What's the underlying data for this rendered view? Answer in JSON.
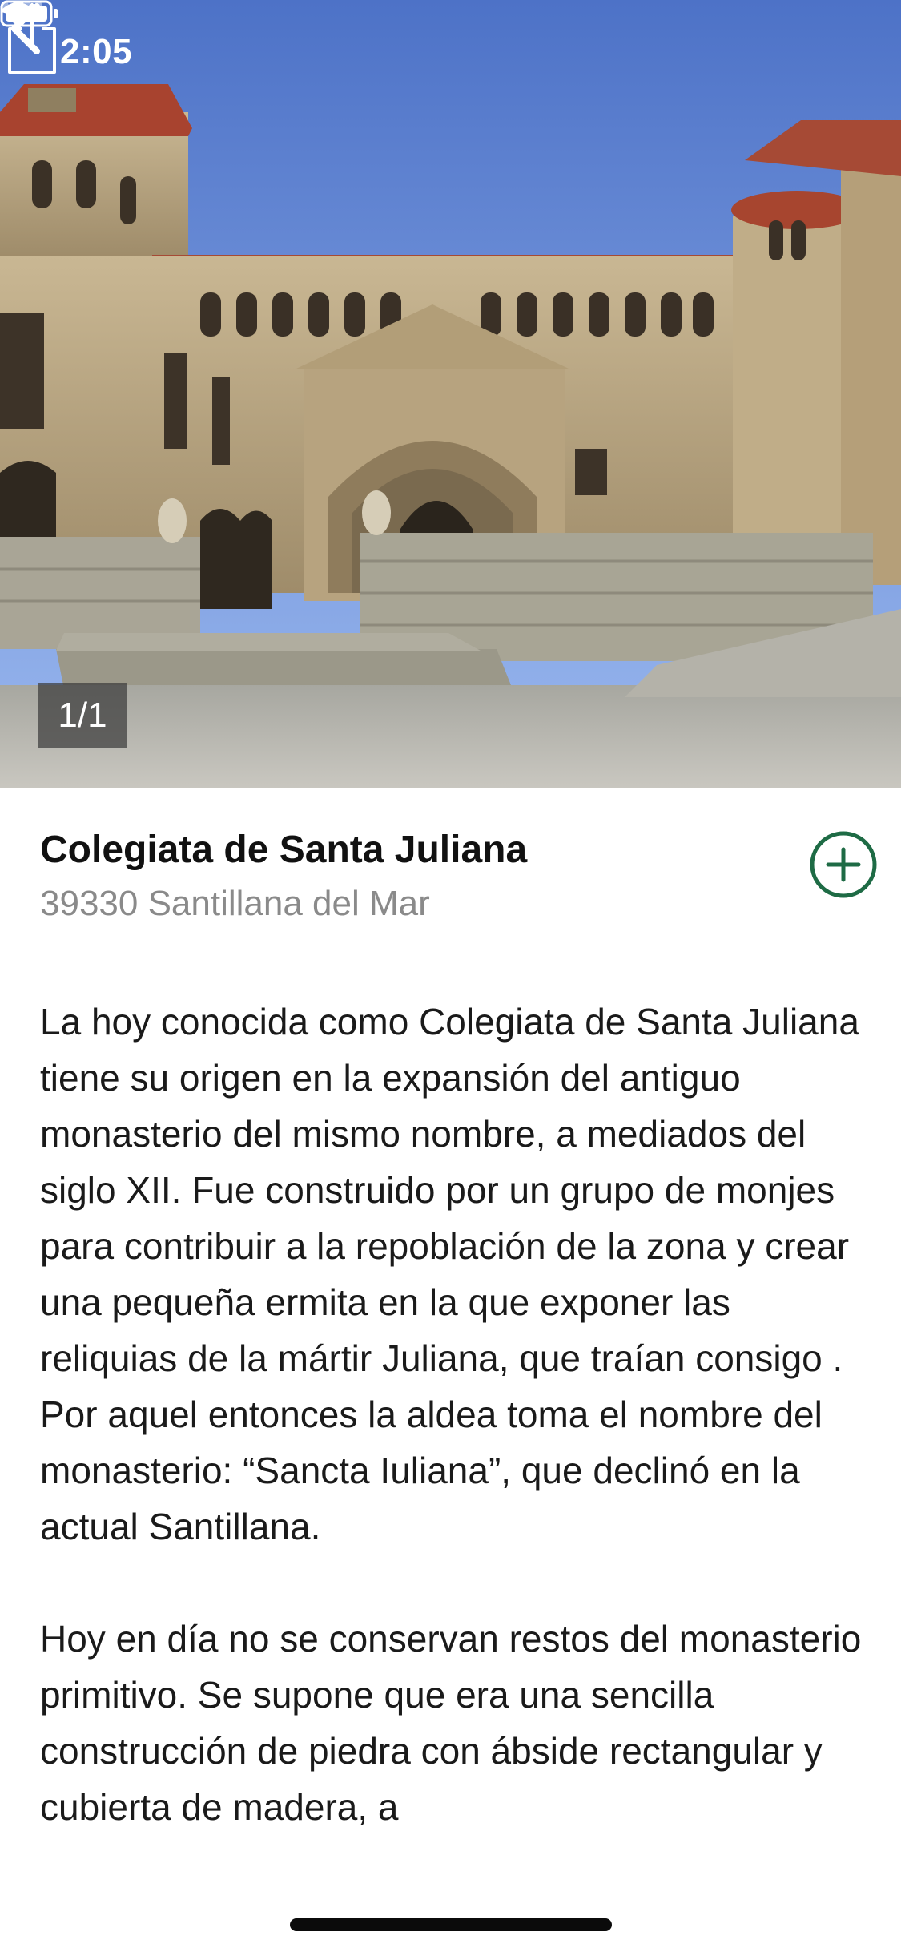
{
  "status_bar": {
    "time": "2:05"
  },
  "hero": {
    "photo_counter": "1/1",
    "sky_color": "#7a9de0",
    "stone_color": "#b9a582"
  },
  "place": {
    "title": "Colegiata de Santa Juliana",
    "address": "39330 Santillana del Mar"
  },
  "description": {
    "paragraphs": [
      "La hoy conocida como Colegiata de Santa Juliana tiene su origen en la expansión del antiguo monasterio del mismo nombre, a mediados del siglo XII. Fue construido por un grupo de monjes para contribuir a la repoblación de la zona y crear una pequeña ermita en la que exponer las reliquias de la mártir Juliana, que traían consigo . Por aquel entonces la aldea toma el nombre del monasterio: “Sancta Iuliana”, que declinó en la actual Santillana.",
      "Hoy en día no se conservan restos del monasterio primitivo. Se supone que era una sencilla construcción de piedra con ábside rectangular y cubierta de madera, a"
    ]
  },
  "icons": {
    "back": "chevron-left-icon",
    "share": "share-icon",
    "add": "plus-circle-icon",
    "location": "location-arrow-icon",
    "wifi": "wifi-icon",
    "battery": "battery-icon"
  },
  "colors": {
    "accent": "#1e6b45",
    "title": "#111111",
    "address": "#8a8a8a",
    "body": "#1a1a1a"
  }
}
